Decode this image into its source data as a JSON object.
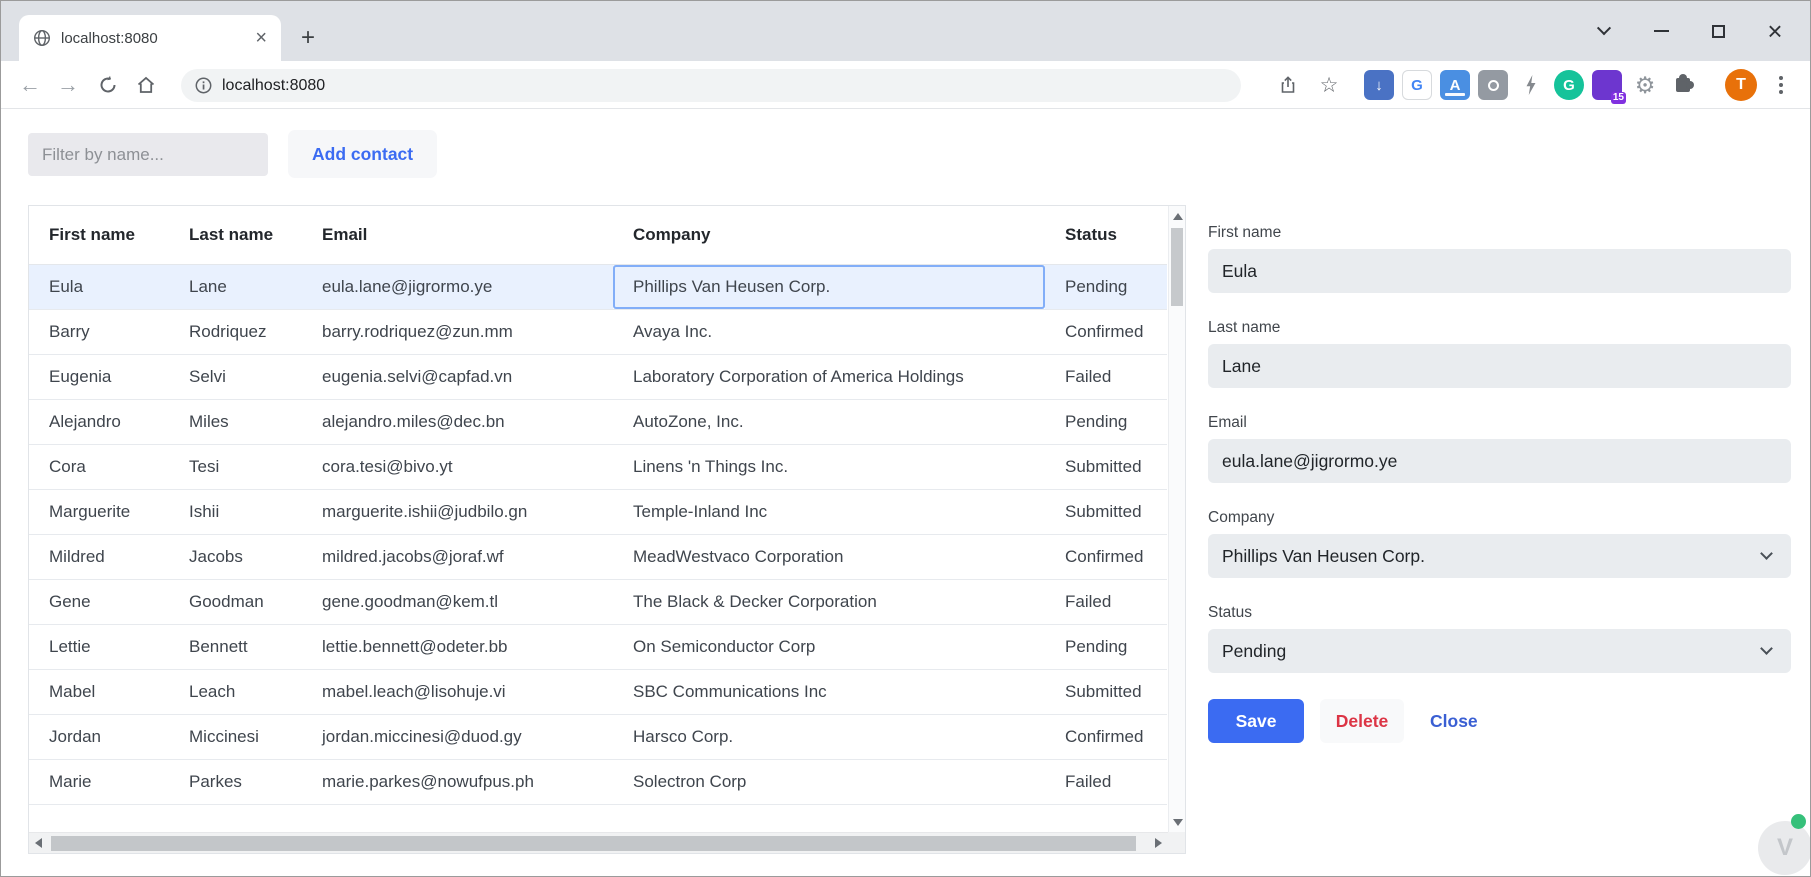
{
  "browser": {
    "tab": {
      "title": "localhost:8080"
    },
    "address": {
      "url": "localhost:8080"
    },
    "avatar_letter": "T",
    "extensions": [
      {
        "name": "download-extension-icon",
        "style_key": "download",
        "glyph": "↓",
        "bg": "#4a72c4",
        "fg": "#ffffff"
      },
      {
        "name": "translate-extension-icon",
        "style_key": "translate",
        "glyph": "G",
        "bg": "#ffffff",
        "fg": "#4285f4",
        "border": "#d7dadd"
      },
      {
        "name": "input-tools-extension-icon",
        "style_key": "akey",
        "glyph": "A",
        "bg": "#4a8fe2",
        "fg": "#ffffff"
      },
      {
        "name": "camera-extension-icon",
        "style_key": "camera",
        "glyph": "",
        "bg": "#949aa2",
        "fg": "#ffffff"
      },
      {
        "name": "lightning-extension-icon",
        "style_key": "bolt",
        "glyph": "",
        "bg": "transparent",
        "fg": "#85898e"
      },
      {
        "name": "grammarly-extension-icon",
        "style_key": "grammarly",
        "glyph": "G",
        "bg": "#15c39a",
        "fg": "#ffffff"
      },
      {
        "name": "purple-extension-icon",
        "style_key": "purple",
        "glyph": "",
        "bg": "#6d36cf",
        "fg": "#ffffff",
        "badge": "15"
      },
      {
        "name": "gear-extension-icon",
        "style_key": "gear",
        "glyph": "⚙",
        "bg": "transparent",
        "fg": "#8f959b"
      },
      {
        "name": "puzzle-extensions-icon",
        "style_key": "puzzle",
        "glyph": "",
        "bg": "transparent",
        "fg": "#5f6368"
      }
    ]
  },
  "page": {
    "filter_placeholder": "Filter by name...",
    "add_contact_label": "Add contact"
  },
  "table": {
    "columns": [
      "First name",
      "Last name",
      "Email",
      "Company",
      "Status"
    ],
    "selected_row_index": 0,
    "focused_column": "company",
    "rows": [
      {
        "first": "Eula",
        "last": "Lane",
        "email": "eula.lane@jigrormo.ye",
        "company": "Phillips Van Heusen Corp.",
        "status": "Pending"
      },
      {
        "first": "Barry",
        "last": "Rodriquez",
        "email": "barry.rodriquez@zun.mm",
        "company": "Avaya Inc.",
        "status": "Confirmed"
      },
      {
        "first": "Eugenia",
        "last": "Selvi",
        "email": "eugenia.selvi@capfad.vn",
        "company": "Laboratory Corporation of America Holdings",
        "status": "Failed"
      },
      {
        "first": "Alejandro",
        "last": "Miles",
        "email": "alejandro.miles@dec.bn",
        "company": "AutoZone, Inc.",
        "status": "Pending"
      },
      {
        "first": "Cora",
        "last": "Tesi",
        "email": "cora.tesi@bivo.yt",
        "company": "Linens 'n Things Inc.",
        "status": "Submitted"
      },
      {
        "first": "Marguerite",
        "last": "Ishii",
        "email": "marguerite.ishii@judbilo.gn",
        "company": "Temple-Inland Inc",
        "status": "Submitted"
      },
      {
        "first": "Mildred",
        "last": "Jacobs",
        "email": "mildred.jacobs@joraf.wf",
        "company": "MeadWestvaco Corporation",
        "status": "Confirmed"
      },
      {
        "first": "Gene",
        "last": "Goodman",
        "email": "gene.goodman@kem.tl",
        "company": "The Black & Decker Corporation",
        "status": "Failed"
      },
      {
        "first": "Lettie",
        "last": "Bennett",
        "email": "lettie.bennett@odeter.bb",
        "company": "On Semiconductor Corp",
        "status": "Pending"
      },
      {
        "first": "Mabel",
        "last": "Leach",
        "email": "mabel.leach@lisohuje.vi",
        "company": "SBC Communications Inc",
        "status": "Submitted"
      },
      {
        "first": "Jordan",
        "last": "Miccinesi",
        "email": "jordan.miccinesi@duod.gy",
        "company": "Harsco Corp.",
        "status": "Confirmed"
      },
      {
        "first": "Marie",
        "last": "Parkes",
        "email": "marie.parkes@nowufpus.ph",
        "company": "Solectron Corp",
        "status": "Failed"
      }
    ]
  },
  "form": {
    "fields": [
      {
        "key": "first-name",
        "label": "First name",
        "value": "Eula",
        "type": "input"
      },
      {
        "key": "last-name",
        "label": "Last name",
        "value": "Lane",
        "type": "input"
      },
      {
        "key": "email",
        "label": "Email",
        "value": "eula.lane@jigrormo.ye",
        "type": "input"
      },
      {
        "key": "company",
        "label": "Company",
        "value": "Phillips Van Heusen Corp.",
        "type": "select"
      },
      {
        "key": "status",
        "label": "Status",
        "value": "Pending",
        "type": "select"
      }
    ],
    "buttons": {
      "save": "Save",
      "delete": "Delete",
      "close": "Close"
    }
  },
  "colors": {
    "accent_blue": "#3b6bf2",
    "close_blue": "#3a5fd3",
    "delete_red": "#dc3545",
    "selected_row": "#e9f1fe",
    "focus_border": "#82aef8",
    "avatar_orange": "#e8710a",
    "vue_green": "#36c07a"
  }
}
